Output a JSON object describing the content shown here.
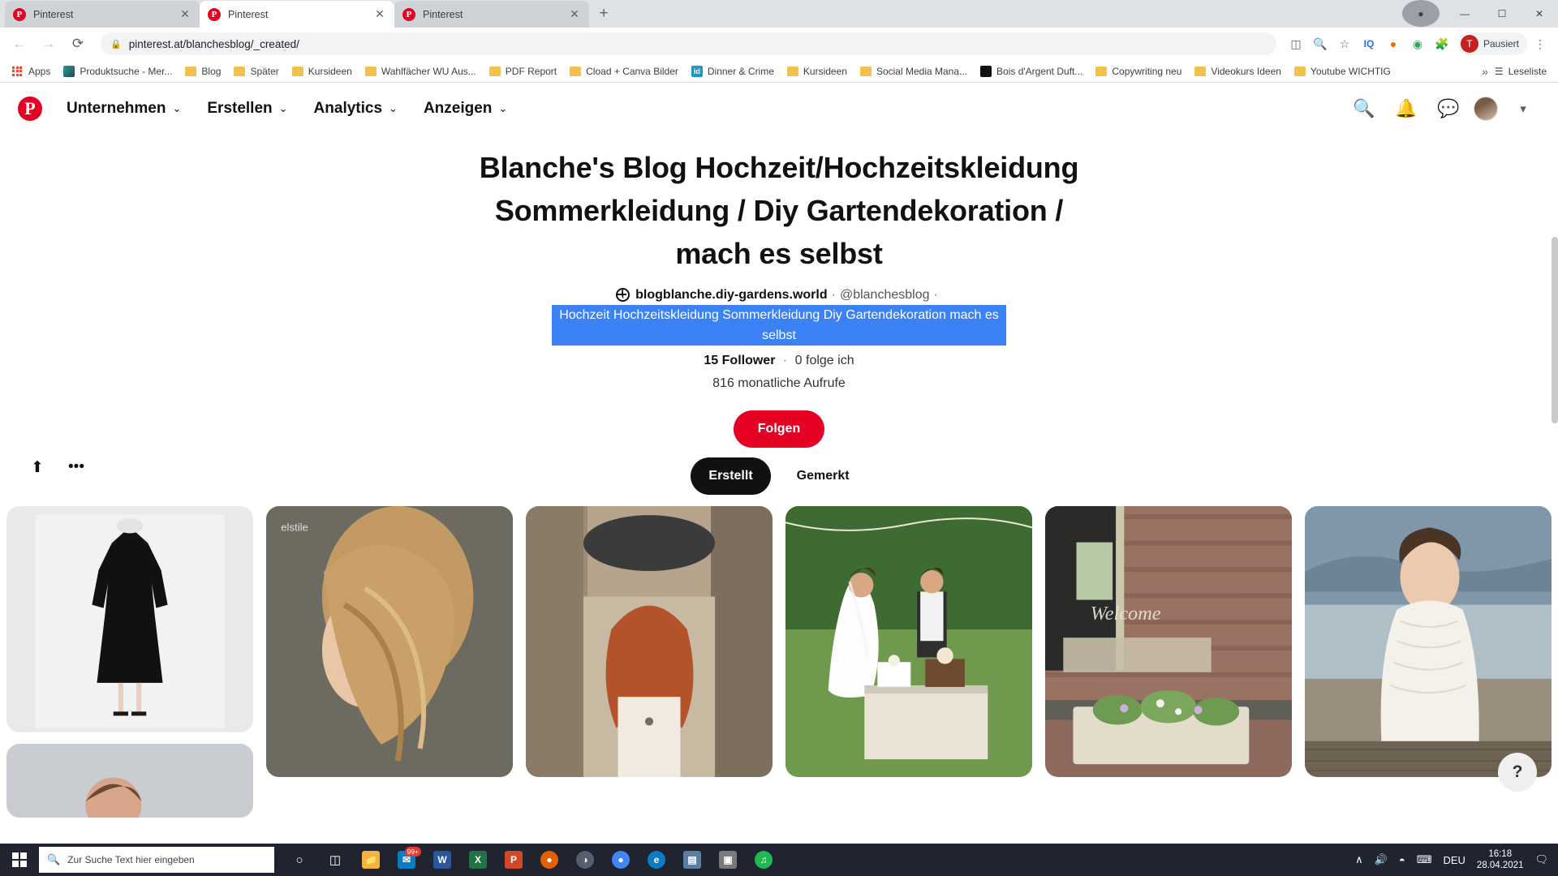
{
  "browser": {
    "tabs": [
      {
        "title": "Pinterest",
        "active": false,
        "favicon": "pinterest-icon"
      },
      {
        "title": "Pinterest",
        "active": true,
        "favicon": "pinterest-icon"
      },
      {
        "title": "Pinterest",
        "active": false,
        "favicon": "pinterest-icon"
      }
    ],
    "new_tab_label": "+",
    "window_controls": {
      "minimize": "—",
      "maximize": "☐",
      "close": "✕"
    },
    "nav": {
      "back": "←",
      "forward": "→",
      "reload": "⟳"
    },
    "omnibox": {
      "lock": "🔒",
      "url": "pinterest.at/blanchesblog/_created/"
    },
    "toolbar_icons": [
      "cast-icon",
      "zoom-icon",
      "star-icon",
      "iq-icon",
      "shield-icon",
      "globe-icon",
      "puzzle-icon"
    ],
    "profile": {
      "initial": "T",
      "label": "Pausiert"
    },
    "menu_icon": "⋮",
    "bookmarks": [
      {
        "label": "Apps",
        "icon": "apps-grid-icon"
      },
      {
        "label": "Produktsuche - Mer...",
        "icon": "site-favicon"
      },
      {
        "label": "Blog",
        "icon": "folder-icon"
      },
      {
        "label": "Später",
        "icon": "folder-icon"
      },
      {
        "label": "Kursideen",
        "icon": "folder-icon"
      },
      {
        "label": "Wahlfächer WU Aus...",
        "icon": "folder-icon"
      },
      {
        "label": "PDF Report",
        "icon": "folder-icon"
      },
      {
        "label": "Cload + Canva Bilder",
        "icon": "folder-icon"
      },
      {
        "label": "Dinner & Crime",
        "icon": "id-favicon"
      },
      {
        "label": "Kursideen",
        "icon": "folder-icon"
      },
      {
        "label": "Social Media Mana...",
        "icon": "folder-icon"
      },
      {
        "label": "Bois d'Argent Duft...",
        "icon": "dark-favicon"
      },
      {
        "label": "Copywriting neu",
        "icon": "folder-icon"
      },
      {
        "label": "Videokurs Ideen",
        "icon": "folder-icon"
      },
      {
        "label": "Youtube WICHTIG",
        "icon": "folder-icon"
      }
    ],
    "bookmarks_overflow": "»",
    "reading_list": "Leseliste"
  },
  "pinterest": {
    "logo": "P",
    "nav": [
      {
        "label": "Unternehmen",
        "chevron": "⌄"
      },
      {
        "label": "Erstellen",
        "chevron": "⌄"
      },
      {
        "label": "Analytics",
        "chevron": "⌄"
      },
      {
        "label": "Anzeigen",
        "chevron": "⌄"
      }
    ],
    "header_icons": [
      "search-icon",
      "bell-icon",
      "chat-icon",
      "avatar",
      "chevron-down-icon"
    ],
    "profile": {
      "title": "Blanche's Blog Hochzeit/Hochzeitskleidung Sommerkleidung / Diy Gartendekoration / mach es selbst",
      "website": "blogblanche.diy-gardens.world",
      "handle": "@blanchesblog",
      "description_selected": "Hochzeit Hochzeitskleidung Sommerkleidung Diy Gartendekoration mach es selbst",
      "followers_count": "15",
      "followers_label": "Follower",
      "following": "0 folge ich",
      "monthly_views": "816 monatliche Aufrufe",
      "follow_button": "Folgen",
      "separator": "·"
    },
    "tools": {
      "share": "share-icon",
      "more": "•••"
    },
    "tabs": [
      {
        "label": "Erstellt",
        "active": true
      },
      {
        "label": "Gemerkt",
        "active": false
      }
    ],
    "help_button": "?",
    "pins": [
      {
        "name": "black-dress-pin",
        "alt": "black knee-length dress on mannequin"
      },
      {
        "name": "braided-hair-pin",
        "alt": "braided blonde hairstyle",
        "watermark": "elstile"
      },
      {
        "name": "red-hair-girl-pin",
        "alt": "woman with red hair on street"
      },
      {
        "name": "wedding-buffet-pin",
        "alt": "bride and groom at outdoor buffet"
      },
      {
        "name": "welcome-sign-pin",
        "alt": "welcome sign with flower box",
        "watermark": "Welcome"
      },
      {
        "name": "lace-dress-bride-pin",
        "alt": "bride in lace dress by lake"
      },
      {
        "name": "bottom-left-pin",
        "alt": "partially visible pin"
      }
    ]
  },
  "taskbar": {
    "start_icon": "windows-icon",
    "search_placeholder": "Zur Suche Text hier eingeben",
    "search_icon": "magnifier-icon",
    "apps": [
      {
        "name": "cortana-icon",
        "glyph": "○",
        "color": "transparent"
      },
      {
        "name": "task-view-icon",
        "glyph": "⌷",
        "color": "transparent"
      },
      {
        "name": "file-explorer-icon",
        "glyph": "🗀",
        "color": "#f6b33d"
      },
      {
        "name": "mail-icon",
        "glyph": "✉",
        "color": "#0a7cc4",
        "badge": "99+"
      },
      {
        "name": "word-icon",
        "glyph": "W",
        "color": "#2b579a"
      },
      {
        "name": "excel-icon",
        "glyph": "X",
        "color": "#217346"
      },
      {
        "name": "powerpoint-icon",
        "glyph": "P",
        "color": "#d24726"
      },
      {
        "name": "firefox-icon",
        "glyph": "◑",
        "color": "#e66000"
      },
      {
        "name": "browser-icon",
        "glyph": "◔",
        "color": "#4b4b4b"
      },
      {
        "name": "chrome-icon",
        "glyph": "●",
        "color": "#4285f4"
      },
      {
        "name": "edge-icon",
        "glyph": "e",
        "color": "#0a7cc4"
      },
      {
        "name": "calculator-icon",
        "glyph": "☷",
        "color": "#5a7fa5"
      },
      {
        "name": "photos-icon",
        "glyph": "▣",
        "color": "#7a7a7a"
      },
      {
        "name": "spotify-icon",
        "glyph": "♫",
        "color": "#1db954"
      }
    ],
    "tray": {
      "chevron": "∧",
      "volume": "volume-icon",
      "wifi": "wifi-icon",
      "keyboard": "keyboard-icon",
      "language": "DEU",
      "time": "16:18",
      "date": "28.04.2021",
      "notifications": "notification-icon"
    }
  }
}
